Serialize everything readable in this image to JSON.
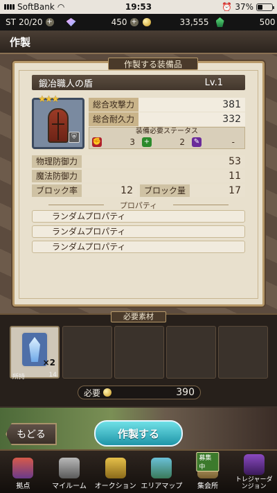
{
  "statusbar": {
    "carrier": "SoftBank",
    "time": "19:53",
    "battery": "37%"
  },
  "resources": {
    "st_label": "ST",
    "stamina": "20/20",
    "gems": "450",
    "gold": "33,555",
    "green": "500"
  },
  "header": {
    "title": "作製"
  },
  "panel": {
    "title": "作製する装備品",
    "item_name": "鍛冶職人の盾",
    "level": "Lv.1",
    "stars": "★★★",
    "stats": {
      "attack_label": "総合攻撃力",
      "attack_value": "381",
      "defense_label": "総合耐久力",
      "defense_value": "332"
    },
    "requirements": {
      "title": "装備必要ステータス",
      "red": "3",
      "green": "2",
      "purple": "-"
    },
    "details": {
      "phys_label": "物理防御力",
      "phys_value": "53",
      "magic_label": "魔法防御力",
      "magic_value": "11",
      "block_rate_label": "ブロック率",
      "block_rate_value": "12",
      "block_amt_label": "ブロック量",
      "block_amt_value": "17"
    },
    "properties_title": "プロパティ",
    "properties": [
      "ランダムプロパティ",
      "ランダムプロパティ",
      "ランダムプロパティ"
    ]
  },
  "materials": {
    "title": "必要素材",
    "slot1_qty": "×2",
    "owned_label": "所持",
    "owned_value": "14",
    "cost_label": "必要",
    "cost_value": "390"
  },
  "buttons": {
    "back": "もどる",
    "craft": "作製する"
  },
  "nav": [
    {
      "label": "拠点"
    },
    {
      "label": "マイルーム"
    },
    {
      "label": "オークション"
    },
    {
      "label": "エリアマップ"
    },
    {
      "label": "集会所",
      "badge": "募集中"
    },
    {
      "label": "トレジャーダンジョン"
    }
  ]
}
